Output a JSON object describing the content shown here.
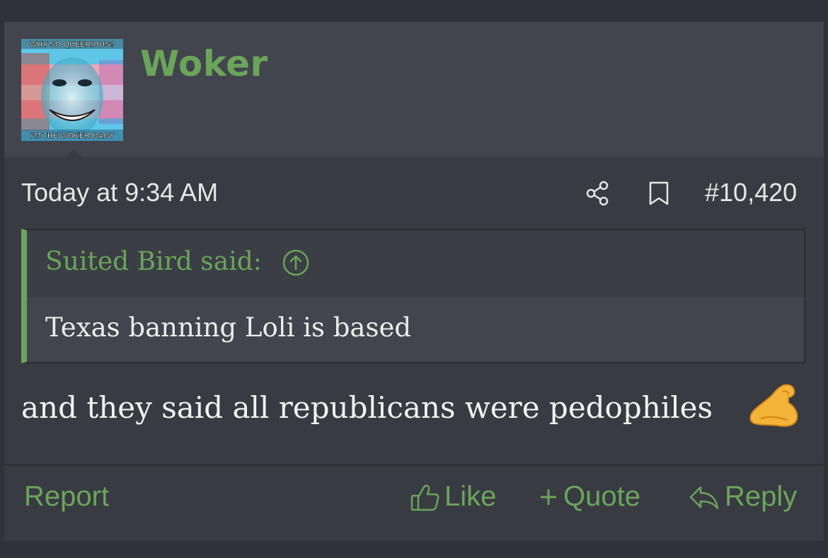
{
  "post": {
    "username": "Woker",
    "avatar_top_text": "WHY SO QUEERIOUS?",
    "avatar_bottom_text": "I'M THE WOKER BABY",
    "date": "Today at 9:34 AM",
    "post_number": "#10,420",
    "quote": {
      "author": "Suited Bird said:",
      "text": "Texas banning Loli is based"
    },
    "message": "and they said all republicans were pedophiles",
    "message_emoji": "flexed-biceps"
  },
  "actions": {
    "report": "Report",
    "like": "Like",
    "quote": "Quote",
    "reply": "Reply"
  },
  "icons": {
    "share": "share-icon",
    "bookmark": "bookmark-icon",
    "quote_jump": "arrow-up-circle-icon",
    "like": "thumbs-up-icon",
    "quote": "plus-icon",
    "reply": "reply-icon"
  },
  "colors": {
    "accent": "#6aa55a",
    "background": "#383b42",
    "header": "#42454d"
  }
}
